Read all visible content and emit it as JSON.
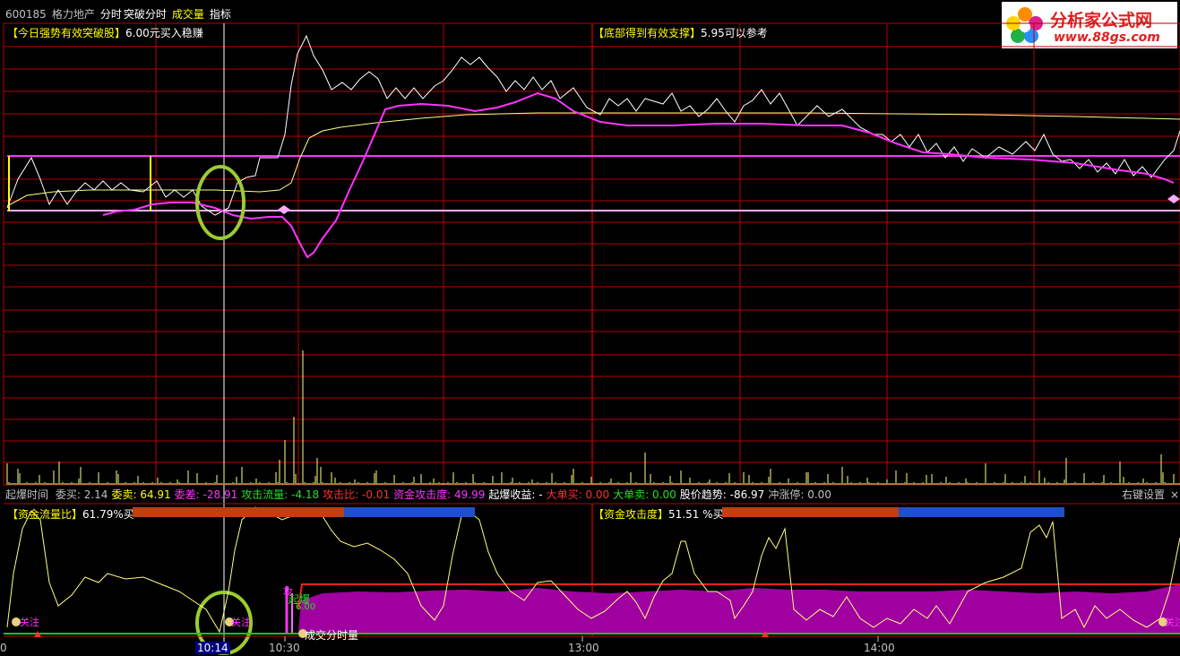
{
  "header": {
    "code": "600185",
    "name": "格力地产",
    "mode": "分时",
    "indicator1": "突破分时",
    "indicator2": "成交量",
    "indicator3": "指标"
  },
  "main_panel": {
    "signal_left_title": "【今日强势有效突破股】",
    "signal_left_text": "6.00元买入稳赚",
    "signal_right_title": "【底部得到有效支撑】",
    "signal_right_text": "5.95可以参考"
  },
  "stats": {
    "items": [
      {
        "label": "起爆时间",
        "value": ""
      },
      {
        "label": "委买:",
        "value": "2.14"
      },
      {
        "label": "委卖:",
        "value": "64.91"
      },
      {
        "label": "委差:",
        "value": "-28.91"
      },
      {
        "label": "攻击流量:",
        "value": "-4.18"
      },
      {
        "label": "攻击比:",
        "value": "-0.01"
      },
      {
        "label": "资金攻击度:",
        "value": "49.99"
      },
      {
        "label": "起爆收益:",
        "value": "-"
      },
      {
        "label": "大单买:",
        "value": "0.00"
      },
      {
        "label": "大单卖:",
        "value": "0.00"
      },
      {
        "label": "股价趋势:",
        "value": "-86.97"
      },
      {
        "label": "冲涨停:",
        "value": "0.00"
      }
    ],
    "right_settings": "右键设置",
    "close": "×"
  },
  "lower_panel": {
    "left_title": "【资金流量比】",
    "left_value": "61.79%买",
    "left_bar_fraction": 0.618,
    "right_title": "【资金攻击度】",
    "right_value": "51.51 %买",
    "right_bar_fraction": 0.515,
    "label_attack": "攻",
    "label_burst": "起爆",
    "label_burst_value": "6.00",
    "label_volume": "成交分时量",
    "label_follow_left": "关注",
    "label_follow_mid": "关注",
    "label_follow_right": "关注"
  },
  "time_axis": {
    "ticks": [
      "0",
      "10:14",
      "10:30",
      "13:00",
      "14:00"
    ]
  },
  "logo": {
    "name": "分析家公式网",
    "url": "www.88gs.com"
  },
  "colors": {
    "red_grid": "#b40000",
    "price_line": "#ffffff",
    "avg_line": "#ffff80",
    "magenta": "#ff33ff",
    "yellow": "#ffff00",
    "green_circle": "#9acd32",
    "purple_fill": "#a000a0",
    "bar_red": "#c04010",
    "bar_blue": "#1e50c8"
  }
}
